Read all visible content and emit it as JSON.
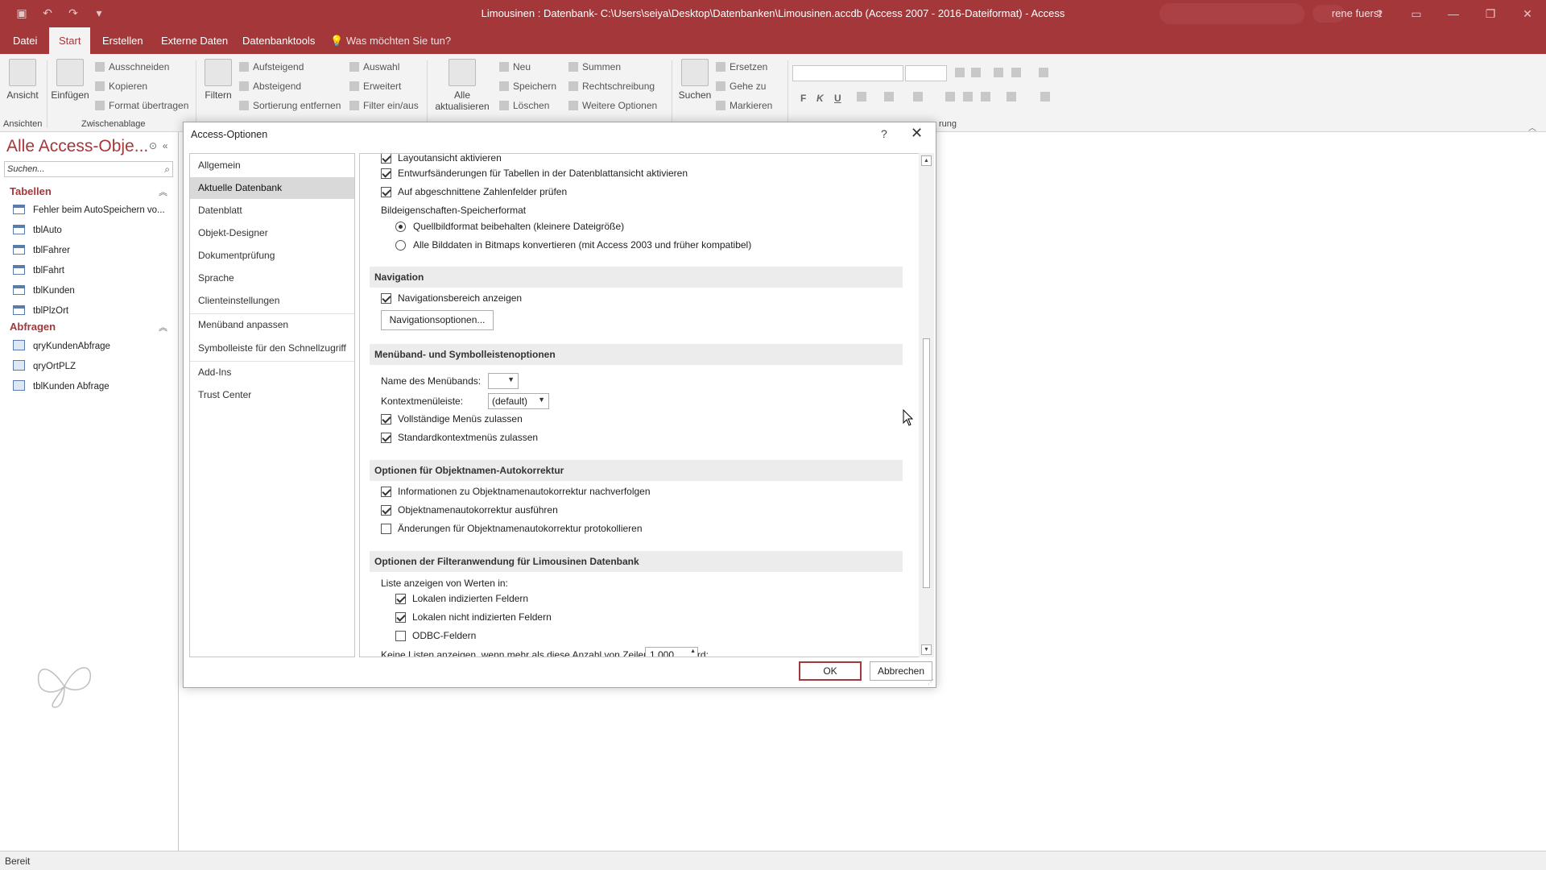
{
  "app": {
    "title": "Limousinen : Datenbank- C:\\Users\\seiya\\Desktop\\Datenbanken\\Limousinen.accdb (Access 2007 - 2016-Dateiformat)  -  Access",
    "user": "rene fuerst"
  },
  "ribbon": {
    "tabs": [
      "Datei",
      "Start",
      "Erstellen",
      "Externe Daten",
      "Datenbanktools"
    ],
    "active_tab": "Start",
    "tell_me": "Was möchten Sie tun?",
    "groups": {
      "ansichten": {
        "label": "Ansichten",
        "view": "Ansicht"
      },
      "zwischenablage": {
        "label": "Zwischenablage",
        "paste": "Einfügen",
        "cut": "Ausschneiden",
        "copy": "Kopieren",
        "format_painter": "Format übertragen"
      },
      "sortieren": {
        "filter": "Filtern",
        "asc": "Aufsteigend",
        "desc": "Absteigend",
        "remove_sort": "Sortierung entfernen",
        "selection": "Auswahl",
        "advanced": "Erweitert",
        "toggle_filter": "Filter ein/aus"
      },
      "datensaetze": {
        "refresh_line1": "Alle",
        "refresh_line2": "aktualisieren",
        "new": "Neu",
        "save": "Speichern",
        "delete": "Löschen",
        "totals": "Summen",
        "spelling": "Rechtschreibung",
        "more": "Weitere Optionen"
      },
      "suchen": {
        "find": "Suchen",
        "replace": "Ersetzen",
        "goto": "Gehe zu",
        "select": "Markieren"
      },
      "text": {
        "label_fragment": "rung",
        "bold": "F",
        "italic": "K",
        "underline": "U"
      }
    }
  },
  "navpane": {
    "title": "Alle Access-Obje...",
    "search_placeholder": "Suchen...",
    "groups": [
      {
        "name": "Tabellen",
        "items": [
          "Fehler beim AutoSpeichern vo...",
          "tblAuto",
          "tblFahrer",
          "tblFahrt",
          "tblKunden",
          "tblPlzOrt"
        ]
      },
      {
        "name": "Abfragen",
        "items": [
          "qryKundenAbfrage",
          "qryOrtPLZ",
          "tblKunden Abfrage"
        ]
      }
    ]
  },
  "status": {
    "text": "Bereit"
  },
  "dialog": {
    "title": "Access-Optionen",
    "help": "?",
    "categories": [
      "Allgemein",
      "Aktuelle Datenbank",
      "Datenblatt",
      "Objekt-Designer",
      "Dokumentprüfung",
      "Sprache",
      "Clienteinstellungen",
      "Menüband anpassen",
      "Symbolleiste für den Schnellzugriff",
      "Add-Ins",
      "Trust Center"
    ],
    "active_category": "Aktuelle Datenbank",
    "options": {
      "layout_view": {
        "label": "Layoutansicht aktivieren",
        "checked": true
      },
      "design_changes": {
        "label": "Entwurfsänderungen für Tabellen in der Datenblattansicht aktivieren",
        "checked": true
      },
      "truncated_numbers": {
        "label": "Auf abgeschnittene Zahlenfelder prüfen",
        "checked": true
      },
      "picture_format_label": "Bildeigenschaften-Speicherformat",
      "picture_keep": {
        "label": "Quellbildformat beibehalten (kleinere Dateigröße)",
        "selected": true
      },
      "picture_bitmap": {
        "label": "Alle Bilddaten in Bitmaps konvertieren (mit Access 2003 und früher kompatibel)",
        "selected": false
      }
    },
    "navigation": {
      "header": "Navigation",
      "show_nav": {
        "label": "Navigationsbereich anzeigen",
        "checked": true
      },
      "nav_options_button": "Navigationsoptionen..."
    },
    "ribbon_options": {
      "header": "Menüband- und Symbolleistenoptionen",
      "ribbon_name_label": "Name des Menübands:",
      "ribbon_name_value": "",
      "context_menu_label": "Kontextmenüleiste:",
      "context_menu_value": "(default)",
      "full_menus": {
        "label": "Vollständige Menüs zulassen",
        "checked": true
      },
      "default_context": {
        "label": "Standardkontextmenüs zulassen",
        "checked": true
      }
    },
    "autocorrect": {
      "header": "Optionen für Objektnamen-Autokorrektur",
      "track": {
        "label": "Informationen zu Objektnamenautokorrektur nachverfolgen",
        "checked": true
      },
      "perform": {
        "label": "Objektnamenautokorrektur ausführen",
        "checked": true
      },
      "log": {
        "label": "Änderungen für Objektnamenautokorrektur protokollieren",
        "checked": false
      }
    },
    "filter": {
      "header": "Optionen der Filteranwendung für Limousinen Datenbank",
      "list_label": "Liste anzeigen von Werten in:",
      "local_indexed": {
        "label": "Lokalen indizierten Feldern",
        "checked": true
      },
      "local_non_indexed": {
        "label": "Lokalen nicht indizierten Feldern",
        "checked": true
      },
      "odbc": {
        "label": "ODBC-Feldern",
        "checked": false
      },
      "max_rows_label": "Keine Listen anzeigen, wenn mehr als diese Anzahl von Zeilen gelesen wird:",
      "max_rows_value": "1.000"
    },
    "ok": "OK",
    "cancel": "Abbrechen"
  },
  "colors": {
    "accent": "#a4373a"
  }
}
